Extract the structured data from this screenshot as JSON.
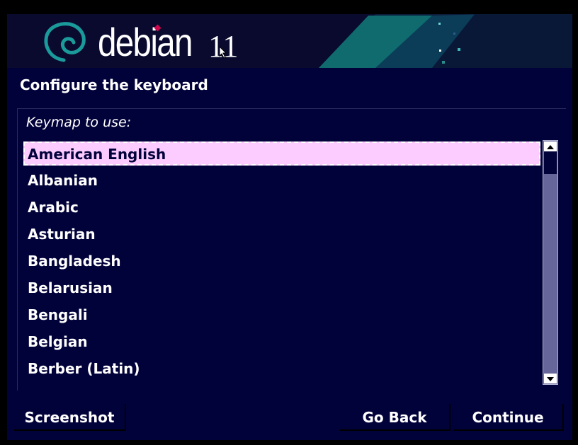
{
  "colors": {
    "background": "#02023a",
    "banner": "#0a0a2e",
    "selection": "#fccbff",
    "scrollbar": "#66669a",
    "accent_red": "#d0074d",
    "accent_teal": "#0f7c7c"
  },
  "banner": {
    "brand": "debian",
    "version": "11",
    "logo_icon": "debian-swirl-icon"
  },
  "title": "Configure the keyboard",
  "prompt": "Keymap to use:",
  "keymaps": [
    "American English",
    "Albanian",
    "Arabic",
    "Asturian",
    "Bangladesh",
    "Belarusian",
    "Bengali",
    "Belgian",
    "Berber (Latin)"
  ],
  "selected_index": 0,
  "buttons": {
    "screenshot": "Screenshot",
    "go_back": "Go Back",
    "continue": "Continue"
  }
}
